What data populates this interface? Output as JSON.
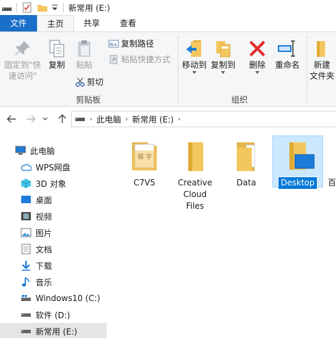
{
  "window": {
    "title": "新常用 (E:)"
  },
  "tabs": [
    {
      "label": "文件"
    },
    {
      "label": "主页"
    },
    {
      "label": "共享"
    },
    {
      "label": "查看"
    }
  ],
  "ribbon": {
    "pin_label_line1": "固定到\"快",
    "pin_label_line2": "速访问\"",
    "copy_label": "复制",
    "paste_label": "粘贴",
    "copy_path_label": "复制路径",
    "paste_shortcut_label": "粘贴快捷方式",
    "cut_label": "剪切",
    "clipboard_group": "剪贴板",
    "move_to_label": "移动到",
    "copy_to_label": "复制到",
    "delete_label": "删除",
    "rename_label": "重命名",
    "organize_group": "组织",
    "new_folder_line1": "新建",
    "new_folder_line2": "文件夹"
  },
  "address": {
    "crumbs": [
      "此电脑",
      "新常用 (E:)"
    ]
  },
  "sidebar": {
    "items": [
      {
        "label": "此电脑",
        "icon": "computer-icon"
      },
      {
        "label": "WPS网盘",
        "icon": "cloud-icon"
      },
      {
        "label": "3D 对象",
        "icon": "3d-objects-icon"
      },
      {
        "label": "桌面",
        "icon": "desktop-icon"
      },
      {
        "label": "视频",
        "icon": "video-icon"
      },
      {
        "label": "图片",
        "icon": "pictures-icon"
      },
      {
        "label": "文档",
        "icon": "documents-icon"
      },
      {
        "label": "下载",
        "icon": "download-icon"
      },
      {
        "label": "音乐",
        "icon": "music-icon"
      },
      {
        "label": "Windows10 (C:)",
        "icon": "drive-icon"
      },
      {
        "label": "软件 (D:)",
        "icon": "drive-icon"
      },
      {
        "label": "新常用 (E:)",
        "icon": "drive-icon"
      }
    ]
  },
  "files": [
    {
      "name": "C7V5",
      "icon": "folder-with-documents-icon"
    },
    {
      "name_line1": "Creative",
      "name_line2": "Cloud",
      "name_line3": "Files",
      "icon": "folder-icon"
    },
    {
      "name": "Data",
      "icon": "folder-with-file-icon"
    },
    {
      "name": "Desktop",
      "icon": "desktop-folder-icon"
    },
    {
      "name": "百",
      "icon": "folder-icon"
    }
  ],
  "colors": {
    "accent": "#1a6fc8",
    "folder": "#f3c75f",
    "selection": "#cce8ff"
  }
}
